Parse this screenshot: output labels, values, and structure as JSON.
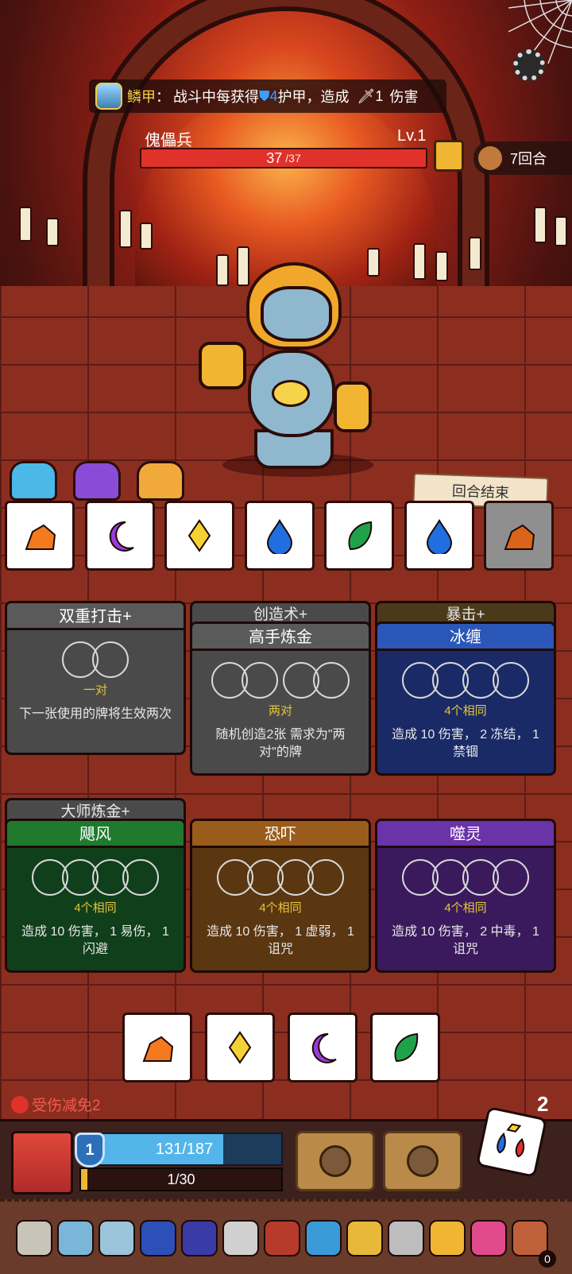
{
  "relic_tip": {
    "name": "鳞甲",
    "sep": "：",
    "desc_pre": "战斗中每获得",
    "shield_value": "4",
    "desc_mid": "护甲，造成",
    "sword_value": "1",
    "desc_post": "伤害"
  },
  "enemy": {
    "name": "傀儡兵",
    "level": "Lv.1",
    "hp_current": "37",
    "hp_max": "/37",
    "hp_fraction": 1.0
  },
  "turns_label": "7回合",
  "end_turn_label": "回合结束",
  "dice_row": [
    {
      "shape": "rock",
      "color": "#f47a1f",
      "used": false
    },
    {
      "shape": "moon",
      "color": "#9b3ad6",
      "used": false
    },
    {
      "shape": "diamond",
      "color": "#f5d233",
      "used": false
    },
    {
      "shape": "drop",
      "color": "#1f6fe0",
      "used": false
    },
    {
      "shape": "leaf",
      "color": "#1ea34a",
      "used": false
    },
    {
      "shape": "drop",
      "color": "#1f6fe0",
      "used": false
    },
    {
      "shape": "rock",
      "color": "#d9641a",
      "used": true
    }
  ],
  "cards": {
    "c1": {
      "title": "双重打击+",
      "requirement": "一对",
      "desc": "下一张使用的牌将生效两次"
    },
    "c2": {
      "tab": "创造术+",
      "title": "高手炼金",
      "requirement": "两对",
      "desc": "随机创造2张 需求为\"两对\"的牌"
    },
    "c3": {
      "tab": "暴击+",
      "title": "冰缠",
      "requirement": "4个相同",
      "desc": "造成 10 伤害， 2 冻结， 1 禁锢"
    },
    "c4": {
      "tab": "大师炼金+",
      "title": "飓风",
      "requirement": "4个相同",
      "desc": "造成 10 伤害， 1 易伤， 1 闪避"
    },
    "c5": {
      "title": "恐吓",
      "requirement": "4个相同",
      "desc": "造成 10 伤害， 1 虚弱， 1 诅咒"
    },
    "c6": {
      "title": "噬灵",
      "requirement": "4个相同",
      "desc": "造成 10 伤害， 2 中毒， 1 诅咒"
    }
  },
  "hand": [
    {
      "shape": "rock",
      "color": "#f47a1f"
    },
    {
      "shape": "diamond",
      "color": "#f5d233"
    },
    {
      "shape": "moon",
      "color": "#9b3ad6"
    },
    {
      "shape": "leaf",
      "color": "#1ea34a"
    }
  ],
  "status": {
    "damage_reduction": "受伤减免2",
    "reroll_count": "2"
  },
  "player": {
    "level": "1",
    "hp_text": "131/187",
    "hp_fraction": 0.7,
    "xp_text": "1/30",
    "xp_fraction": 0.033
  },
  "relics": [
    "horn-icon",
    "fish-blade-icon",
    "conch-icon",
    "blue-flame-icon",
    "star-rune-icon",
    "ring-icon",
    "red-hood-icon",
    "blue-creature-icon",
    "sun-medal-icon",
    "spike-crown-icon",
    "glove-icon",
    "totem-icon",
    "coin-bag-icon"
  ],
  "relic_count": "0",
  "colors": {
    "hp_enemy": "#e0312b",
    "hp_player": "#54b5ea",
    "xp": "#f0b532",
    "accent_gold": "#f5d34a"
  }
}
